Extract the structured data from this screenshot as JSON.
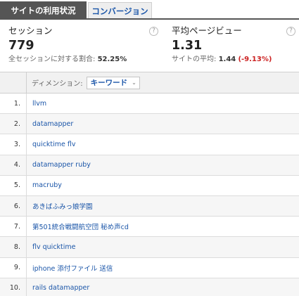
{
  "tabs": [
    {
      "label": "サイトの利用状況",
      "active": true
    },
    {
      "label": "コンバージョン",
      "active": false
    }
  ],
  "metrics": {
    "sessions": {
      "label": "セッション",
      "value": "779",
      "sub_label": "全セッションに対する割合:",
      "sub_value": "52.25%"
    },
    "pages_per_session": {
      "label": "平均ページビュー",
      "value": "1.31",
      "sub_label": "サイトの平均:",
      "sub_value": "1.44",
      "sub_delta": "(-9.13%)"
    }
  },
  "table": {
    "dimension_label": "ディメンション:",
    "dimension_value": "キーワード",
    "rows": [
      {
        "num": "1.",
        "keyword": "llvm"
      },
      {
        "num": "2.",
        "keyword": "datamapper"
      },
      {
        "num": "3.",
        "keyword": "quicktime flv"
      },
      {
        "num": "4.",
        "keyword": "datamapper ruby"
      },
      {
        "num": "5.",
        "keyword": "macruby"
      },
      {
        "num": "6.",
        "keyword": "あきばふみっ娘学園"
      },
      {
        "num": "7.",
        "keyword": "第501統合戦闘航空団 秘め声cd"
      },
      {
        "num": "8.",
        "keyword": "flv quicktime"
      },
      {
        "num": "9.",
        "keyword": "iphone 添付ファイル 送信"
      },
      {
        "num": "10.",
        "keyword": "rails datamapper"
      }
    ]
  },
  "colors": {
    "tab_active_bg": "#555555",
    "link": "#1a55a8",
    "negative": "#cc2222"
  },
  "icons": {
    "help": "?",
    "chevron": "⌄"
  }
}
